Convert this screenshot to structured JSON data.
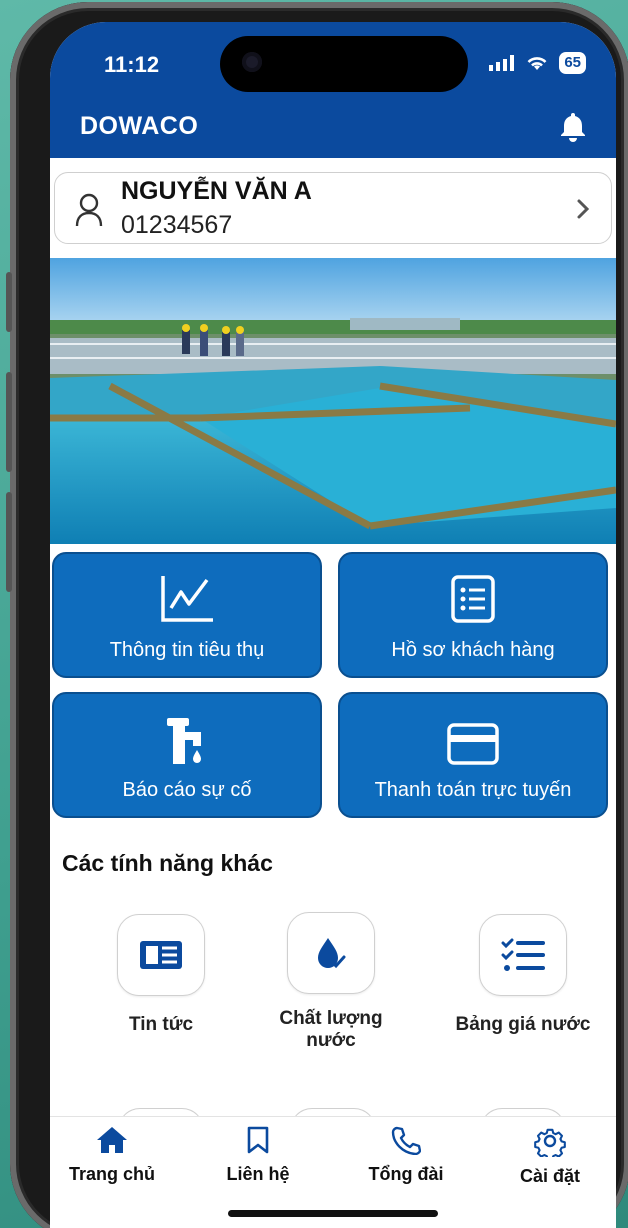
{
  "status_bar": {
    "time": "11:12",
    "battery": "65"
  },
  "header": {
    "app_title": "DOWACO"
  },
  "user": {
    "name": "NGUYỄN VĂN A",
    "account_number": "01234567"
  },
  "main_tiles": [
    {
      "label": "Thông tin tiêu thụ",
      "icon": "chart-icon"
    },
    {
      "label": "Hồ sơ khách hàng",
      "icon": "list-document-icon"
    },
    {
      "label": "Báo cáo sự cố",
      "icon": "faucet-icon"
    },
    {
      "label": "Thanh toán trực tuyến",
      "icon": "credit-card-icon"
    }
  ],
  "other_features": {
    "title": "Các tính năng khác",
    "items": [
      {
        "label": "Tin tức",
        "icon": "newspaper-icon"
      },
      {
        "label": "Chất lượng nước",
        "icon": "water-drop-icon"
      },
      {
        "label": "Bảng giá nước",
        "icon": "checklist-icon"
      }
    ]
  },
  "tab_bar": [
    {
      "label": "Trang chủ",
      "icon": "home-icon"
    },
    {
      "label": "Liên hệ",
      "icon": "bookmark-icon"
    },
    {
      "label": "Tổng đài",
      "icon": "phone-icon"
    },
    {
      "label": "Cài đặt",
      "icon": "gear-icon"
    }
  ],
  "colors": {
    "brand": "#0b4a9e",
    "tile": "#0e6cbd",
    "background": "#4aa898"
  }
}
